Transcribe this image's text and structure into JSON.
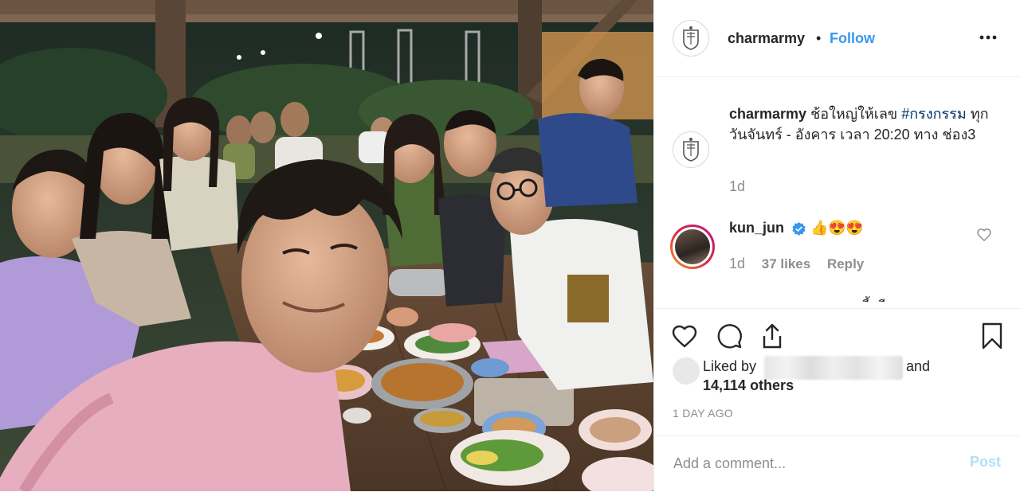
{
  "post": {
    "username": "charmarmy",
    "separator": "•",
    "follow_label": "Follow",
    "more_icon": "more-options-icon"
  },
  "caption": {
    "username": "charmarmy",
    "text_before": "ช้อใหญ่ให้เลข",
    "hashtag": "#กรงกรรม",
    "text_after": "ทุกวันจันทร์ - อังคาร เวลา 20:20 ทาง ช่อง3",
    "time": "1d"
  },
  "comment": {
    "username": "kun_jun",
    "emoji_1": "👍",
    "emoji_2": "😍",
    "emoji_3": "😍",
    "time": "1d",
    "likes": "37 likes",
    "reply_label": "Reply"
  },
  "likes": {
    "prefix": "Liked by",
    "conjunction": "and",
    "others": "14,114 others"
  },
  "timestamp": "1 DAY AGO",
  "add_comment": {
    "placeholder": "Add a comment...",
    "post_label": "Post"
  },
  "colors": {
    "follow": "#3897f0",
    "hashtag": "#003569",
    "muted": "#8e8e8e",
    "post_disabled": "#b2dffc",
    "verified": "#3897f0"
  }
}
